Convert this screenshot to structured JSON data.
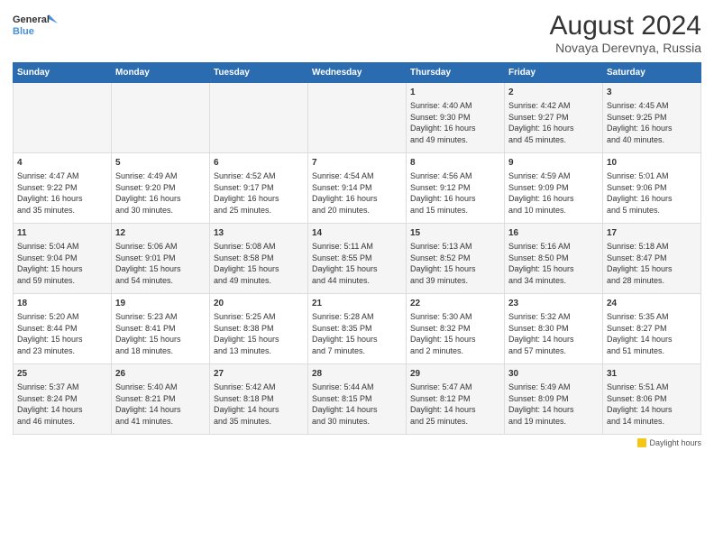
{
  "header": {
    "logo_line1": "General",
    "logo_line2": "Blue",
    "main_title": "August 2024",
    "subtitle": "Novaya Derevnya, Russia"
  },
  "days_of_week": [
    "Sunday",
    "Monday",
    "Tuesday",
    "Wednesday",
    "Thursday",
    "Friday",
    "Saturday"
  ],
  "legend_label": "Daylight hours",
  "weeks": [
    [
      {
        "day": "",
        "content": ""
      },
      {
        "day": "",
        "content": ""
      },
      {
        "day": "",
        "content": ""
      },
      {
        "day": "",
        "content": ""
      },
      {
        "day": "1",
        "content": "Sunrise: 4:40 AM\nSunset: 9:30 PM\nDaylight: 16 hours\nand 49 minutes."
      },
      {
        "day": "2",
        "content": "Sunrise: 4:42 AM\nSunset: 9:27 PM\nDaylight: 16 hours\nand 45 minutes."
      },
      {
        "day": "3",
        "content": "Sunrise: 4:45 AM\nSunset: 9:25 PM\nDaylight: 16 hours\nand 40 minutes."
      }
    ],
    [
      {
        "day": "4",
        "content": "Sunrise: 4:47 AM\nSunset: 9:22 PM\nDaylight: 16 hours\nand 35 minutes."
      },
      {
        "day": "5",
        "content": "Sunrise: 4:49 AM\nSunset: 9:20 PM\nDaylight: 16 hours\nand 30 minutes."
      },
      {
        "day": "6",
        "content": "Sunrise: 4:52 AM\nSunset: 9:17 PM\nDaylight: 16 hours\nand 25 minutes."
      },
      {
        "day": "7",
        "content": "Sunrise: 4:54 AM\nSunset: 9:14 PM\nDaylight: 16 hours\nand 20 minutes."
      },
      {
        "day": "8",
        "content": "Sunrise: 4:56 AM\nSunset: 9:12 PM\nDaylight: 16 hours\nand 15 minutes."
      },
      {
        "day": "9",
        "content": "Sunrise: 4:59 AM\nSunset: 9:09 PM\nDaylight: 16 hours\nand 10 minutes."
      },
      {
        "day": "10",
        "content": "Sunrise: 5:01 AM\nSunset: 9:06 PM\nDaylight: 16 hours\nand 5 minutes."
      }
    ],
    [
      {
        "day": "11",
        "content": "Sunrise: 5:04 AM\nSunset: 9:04 PM\nDaylight: 15 hours\nand 59 minutes."
      },
      {
        "day": "12",
        "content": "Sunrise: 5:06 AM\nSunset: 9:01 PM\nDaylight: 15 hours\nand 54 minutes."
      },
      {
        "day": "13",
        "content": "Sunrise: 5:08 AM\nSunset: 8:58 PM\nDaylight: 15 hours\nand 49 minutes."
      },
      {
        "day": "14",
        "content": "Sunrise: 5:11 AM\nSunset: 8:55 PM\nDaylight: 15 hours\nand 44 minutes."
      },
      {
        "day": "15",
        "content": "Sunrise: 5:13 AM\nSunset: 8:52 PM\nDaylight: 15 hours\nand 39 minutes."
      },
      {
        "day": "16",
        "content": "Sunrise: 5:16 AM\nSunset: 8:50 PM\nDaylight: 15 hours\nand 34 minutes."
      },
      {
        "day": "17",
        "content": "Sunrise: 5:18 AM\nSunset: 8:47 PM\nDaylight: 15 hours\nand 28 minutes."
      }
    ],
    [
      {
        "day": "18",
        "content": "Sunrise: 5:20 AM\nSunset: 8:44 PM\nDaylight: 15 hours\nand 23 minutes."
      },
      {
        "day": "19",
        "content": "Sunrise: 5:23 AM\nSunset: 8:41 PM\nDaylight: 15 hours\nand 18 minutes."
      },
      {
        "day": "20",
        "content": "Sunrise: 5:25 AM\nSunset: 8:38 PM\nDaylight: 15 hours\nand 13 minutes."
      },
      {
        "day": "21",
        "content": "Sunrise: 5:28 AM\nSunset: 8:35 PM\nDaylight: 15 hours\nand 7 minutes."
      },
      {
        "day": "22",
        "content": "Sunrise: 5:30 AM\nSunset: 8:32 PM\nDaylight: 15 hours\nand 2 minutes."
      },
      {
        "day": "23",
        "content": "Sunrise: 5:32 AM\nSunset: 8:30 PM\nDaylight: 14 hours\nand 57 minutes."
      },
      {
        "day": "24",
        "content": "Sunrise: 5:35 AM\nSunset: 8:27 PM\nDaylight: 14 hours\nand 51 minutes."
      }
    ],
    [
      {
        "day": "25",
        "content": "Sunrise: 5:37 AM\nSunset: 8:24 PM\nDaylight: 14 hours\nand 46 minutes."
      },
      {
        "day": "26",
        "content": "Sunrise: 5:40 AM\nSunset: 8:21 PM\nDaylight: 14 hours\nand 41 minutes."
      },
      {
        "day": "27",
        "content": "Sunrise: 5:42 AM\nSunset: 8:18 PM\nDaylight: 14 hours\nand 35 minutes."
      },
      {
        "day": "28",
        "content": "Sunrise: 5:44 AM\nSunset: 8:15 PM\nDaylight: 14 hours\nand 30 minutes."
      },
      {
        "day": "29",
        "content": "Sunrise: 5:47 AM\nSunset: 8:12 PM\nDaylight: 14 hours\nand 25 minutes."
      },
      {
        "day": "30",
        "content": "Sunrise: 5:49 AM\nSunset: 8:09 PM\nDaylight: 14 hours\nand 19 minutes."
      },
      {
        "day": "31",
        "content": "Sunrise: 5:51 AM\nSunset: 8:06 PM\nDaylight: 14 hours\nand 14 minutes."
      }
    ]
  ]
}
